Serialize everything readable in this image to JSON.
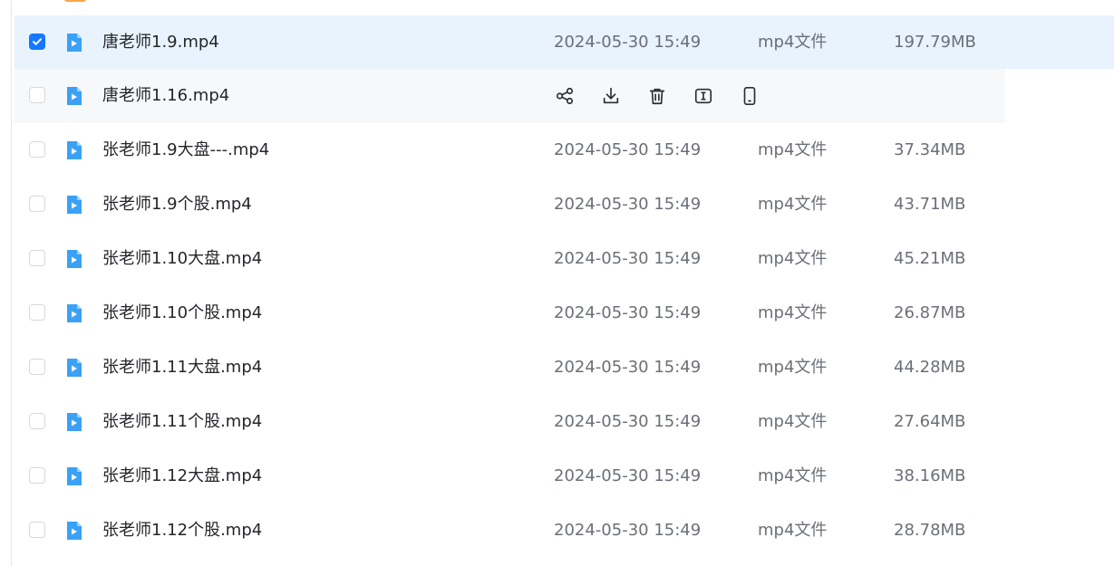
{
  "files": [
    {
      "name": "唐老师1.9.mp4",
      "date": "2024-05-30 15:49",
      "type": "mp4文件",
      "size": "197.79MB",
      "checked": true,
      "hovered": false
    },
    {
      "name": "唐老师1.16.mp4",
      "date": "",
      "type": "",
      "size": "",
      "checked": false,
      "hovered": true
    },
    {
      "name": "张老师1.9大盘---.mp4",
      "date": "2024-05-30 15:49",
      "type": "mp4文件",
      "size": "37.34MB",
      "checked": false,
      "hovered": false
    },
    {
      "name": "张老师1.9个股.mp4",
      "date": "2024-05-30 15:49",
      "type": "mp4文件",
      "size": "43.71MB",
      "checked": false,
      "hovered": false
    },
    {
      "name": "张老师1.10大盘.mp4",
      "date": "2024-05-30 15:49",
      "type": "mp4文件",
      "size": "45.21MB",
      "checked": false,
      "hovered": false
    },
    {
      "name": "张老师1.10个股.mp4",
      "date": "2024-05-30 15:49",
      "type": "mp4文件",
      "size": "26.87MB",
      "checked": false,
      "hovered": false
    },
    {
      "name": "张老师1.11大盘.mp4",
      "date": "2024-05-30 15:49",
      "type": "mp4文件",
      "size": "44.28MB",
      "checked": false,
      "hovered": false
    },
    {
      "name": "张老师1.11个股.mp4",
      "date": "2024-05-30 15:49",
      "type": "mp4文件",
      "size": "27.64MB",
      "checked": false,
      "hovered": false
    },
    {
      "name": "张老师1.12大盘.mp4",
      "date": "2024-05-30 15:49",
      "type": "mp4文件",
      "size": "38.16MB",
      "checked": false,
      "hovered": false
    },
    {
      "name": "张老师1.12个股.mp4",
      "date": "2024-05-30 15:49",
      "type": "mp4文件",
      "size": "28.78MB",
      "checked": false,
      "hovered": false
    }
  ],
  "row_actions": [
    "share-icon",
    "download-icon",
    "delete-icon",
    "rename-icon",
    "phone-icon"
  ],
  "icons": {
    "video_file": "video-file-icon"
  },
  "colors": {
    "accent": "#1677ff",
    "video_icon": "#3ba1f5",
    "selected_row": "#e8f3fd",
    "hover_row": "#f7f8fa",
    "primary_text": "#24262b",
    "secondary_text": "#6b6f77"
  }
}
